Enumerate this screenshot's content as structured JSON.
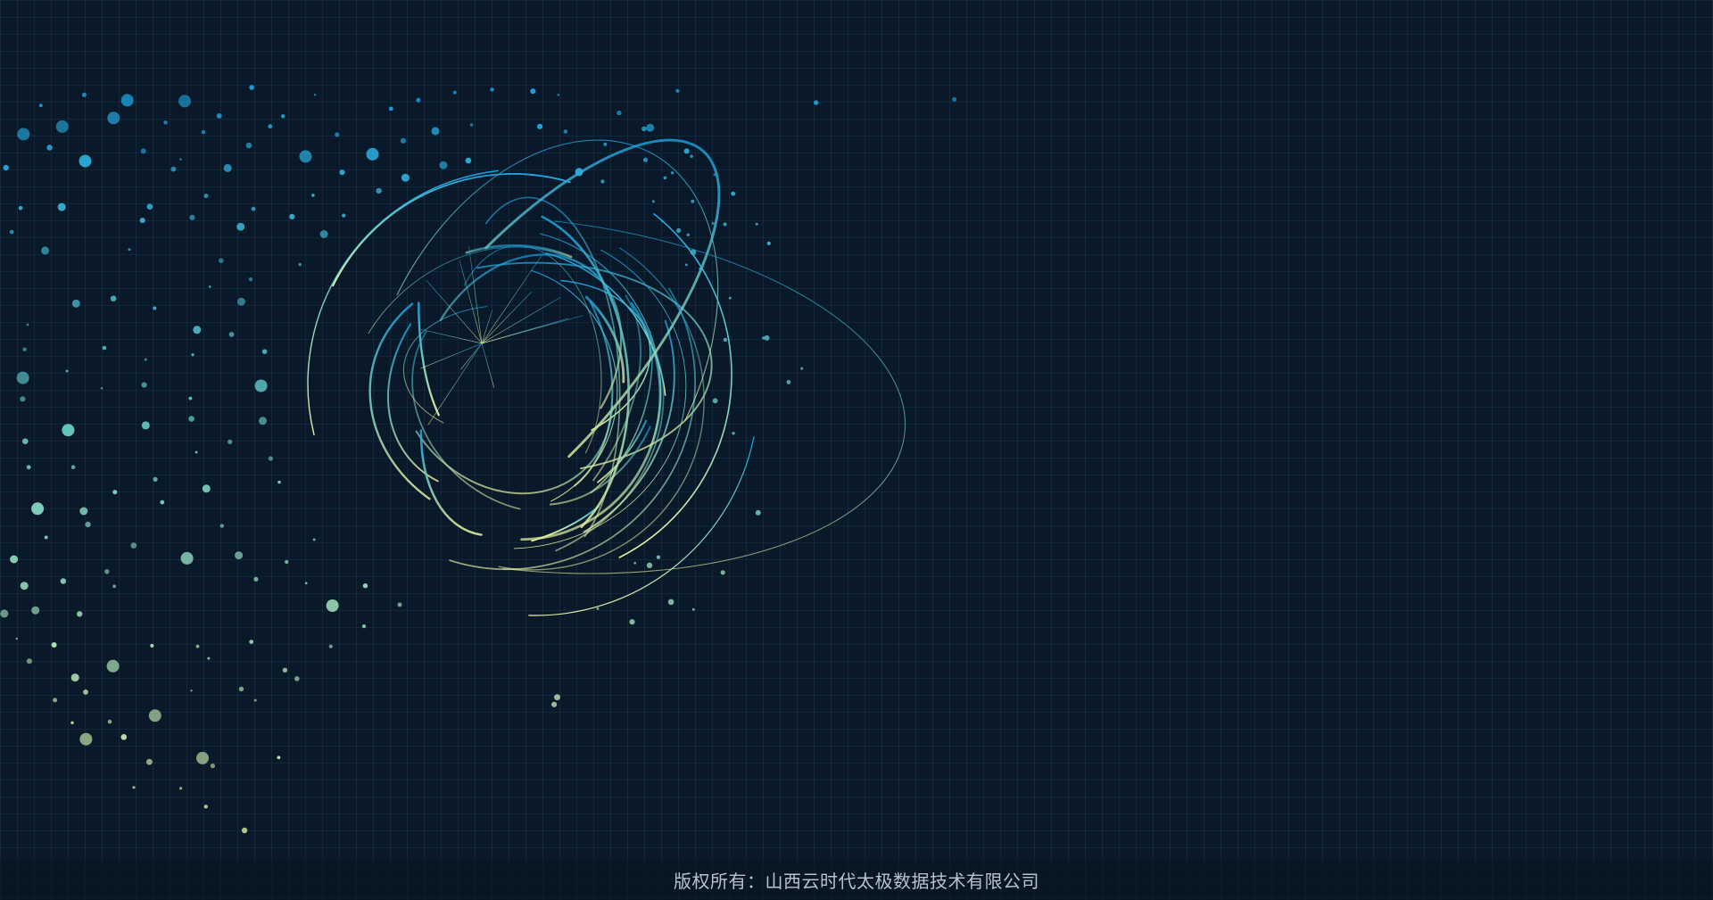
{
  "footer": {
    "copyright_text": "版权所有：山西云时代太极数据技术有限公司"
  },
  "background_graphic": {
    "icon": "globe-particle-sphere-illustration",
    "colors": {
      "background": "#0a1929",
      "grid_line": "#1c3a55",
      "gradient_top": "#1aa3e0",
      "gradient_mid": "#78d2c4",
      "gradient_bottom": "#e6f0a0"
    }
  }
}
